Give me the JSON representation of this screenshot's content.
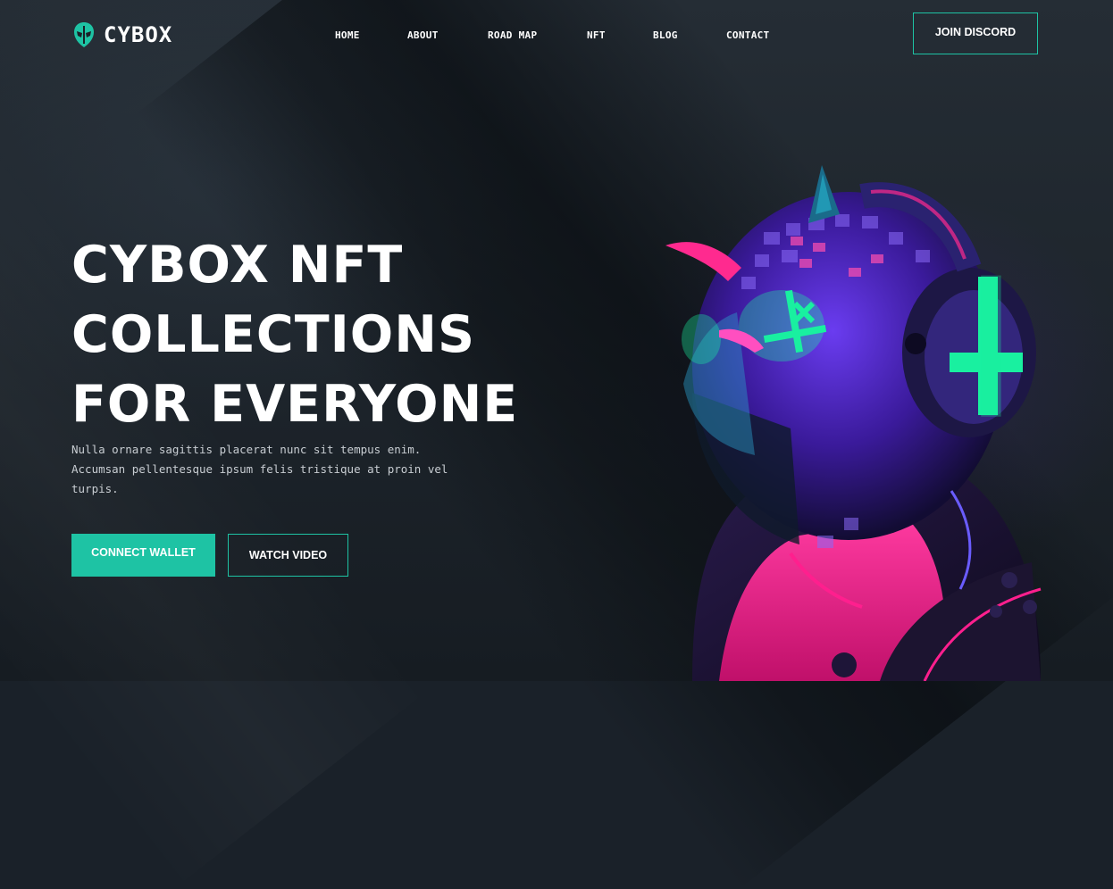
{
  "brand": {
    "name": "CYBOX",
    "logo_icon": "alien-head-icon",
    "accent": "#1ec3a4"
  },
  "nav": {
    "items": [
      "HOME",
      "ABOUT",
      "ROAD MAP",
      "NFT",
      "BLOG",
      "CONTACT"
    ]
  },
  "header": {
    "cta_label": "JOIN DISCORD"
  },
  "hero": {
    "title_lines": [
      "CYBOX NFT",
      "COLLECTIONS",
      "FOR EVERYONE"
    ],
    "description": "Nulla ornare sagittis placerat nunc sit tempus enim. Accumsan pellentesque ipsum felis tristique at proin vel turpis.",
    "primary_button": "CONNECT WALLET",
    "secondary_button": "WATCH VIDEO",
    "illustration": "cyber-devil-helmet-illustration"
  },
  "colors": {
    "background": "#1a2129",
    "neon_green": "#19f0a0",
    "neon_pink": "#ff1f8e",
    "neon_purple": "#5a2ad8"
  }
}
